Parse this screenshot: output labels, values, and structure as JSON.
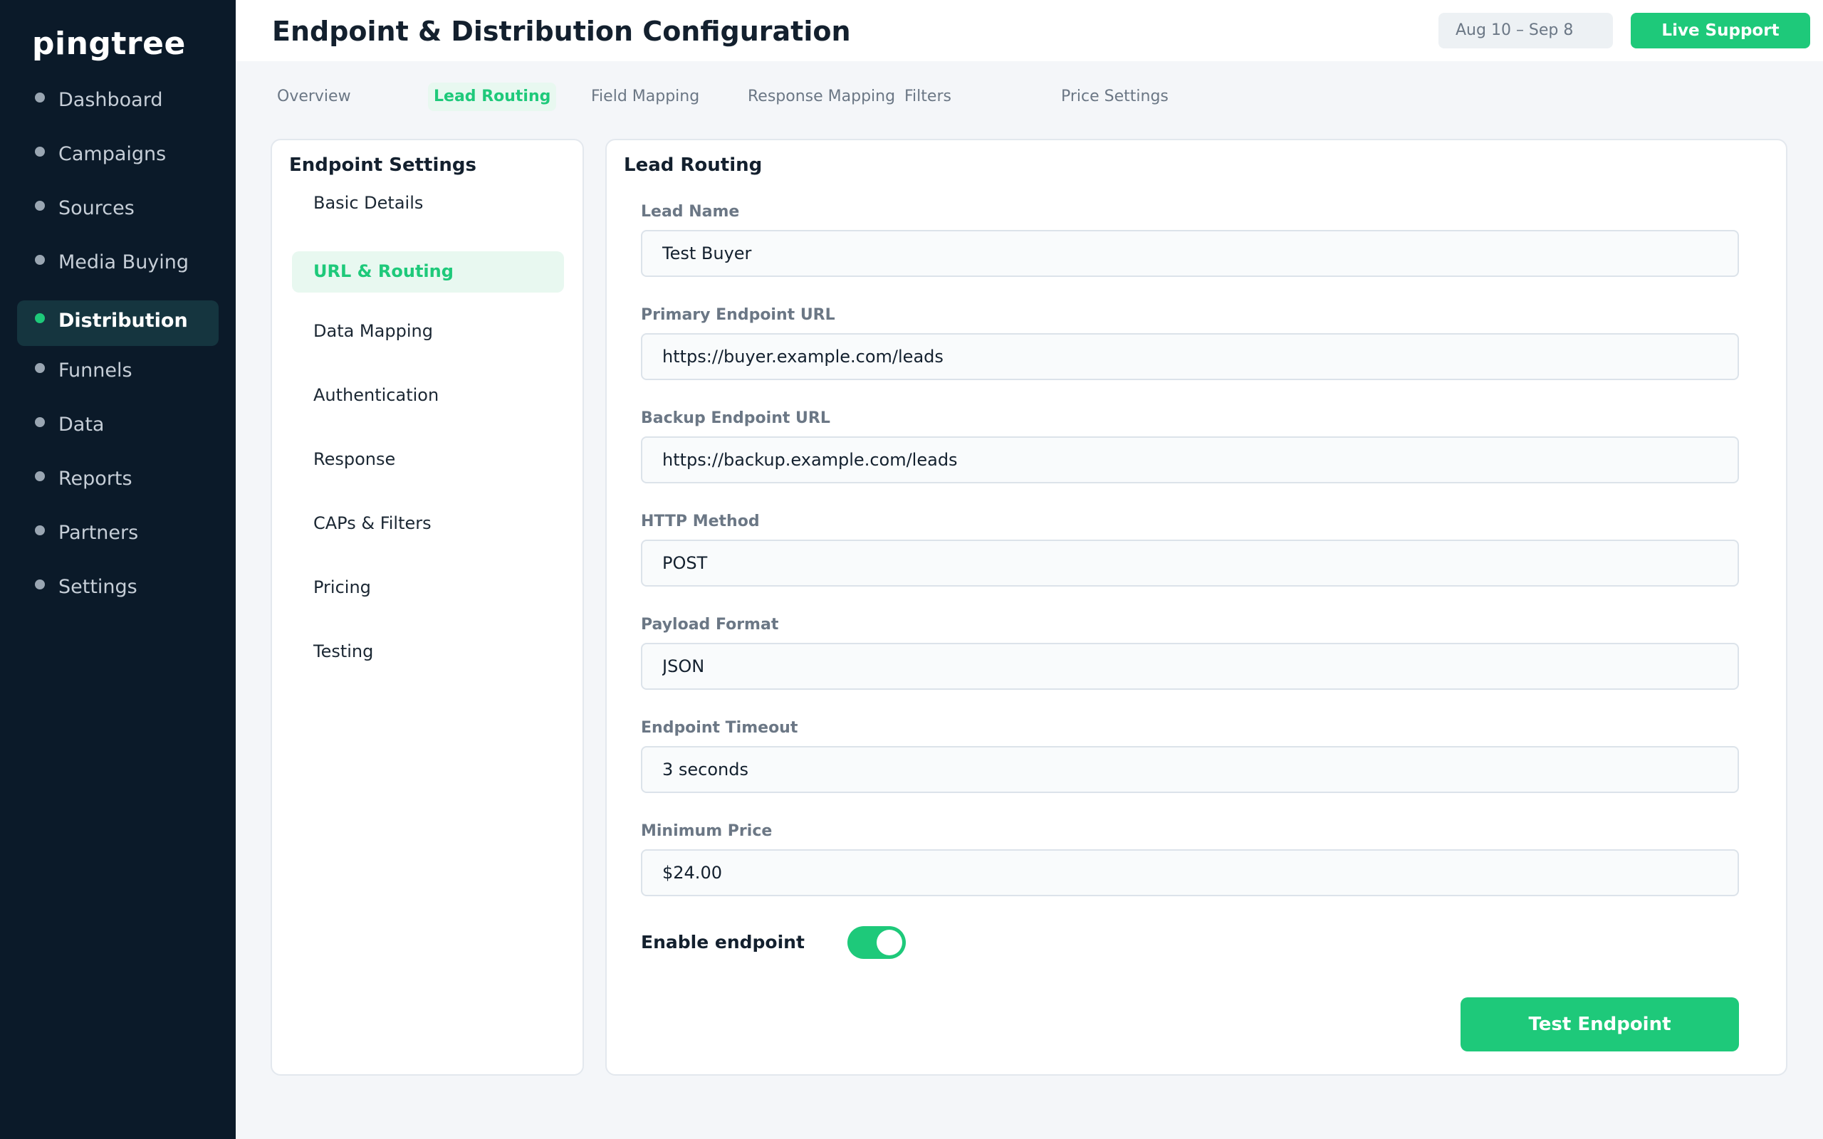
{
  "brand": "pingtree",
  "sidebar": {
    "items": [
      {
        "label": "Dashboard"
      },
      {
        "label": "Campaigns"
      },
      {
        "label": "Sources"
      },
      {
        "label": "Media Buying"
      },
      {
        "label": "Distribution",
        "active": true
      },
      {
        "label": "Funnels"
      },
      {
        "label": "Data"
      },
      {
        "label": "Reports"
      },
      {
        "label": "Partners"
      },
      {
        "label": "Settings"
      }
    ]
  },
  "header": {
    "title": "Endpoint & Distribution Configuration",
    "date_range": "Aug 10 – Sep 8",
    "live_support_label": "Live Support"
  },
  "tabs": [
    {
      "label": "Overview"
    },
    {
      "label": "Lead Routing",
      "active": true
    },
    {
      "label": "Field Mapping"
    },
    {
      "label": "Response Mapping"
    },
    {
      "label": "Filters"
    },
    {
      "label": "Price Settings"
    }
  ],
  "endpoint_settings": {
    "title": "Endpoint Settings",
    "items": [
      {
        "label": "Basic Details"
      },
      {
        "label": "URL & Routing",
        "active": true
      },
      {
        "label": "Data Mapping"
      },
      {
        "label": "Authentication"
      },
      {
        "label": "Response"
      },
      {
        "label": "CAPs & Filters"
      },
      {
        "label": "Pricing"
      },
      {
        "label": "Testing"
      }
    ]
  },
  "lead_routing": {
    "title": "Lead Routing",
    "fields": [
      {
        "label": "Lead Name",
        "value": "Test Buyer"
      },
      {
        "label": "Primary Endpoint URL",
        "value": "https://buyer.example.com/leads"
      },
      {
        "label": "Backup Endpoint URL",
        "value": "https://backup.example.com/leads"
      },
      {
        "label": "HTTP Method",
        "value": "POST"
      },
      {
        "label": "Payload Format",
        "value": "JSON"
      },
      {
        "label": "Endpoint Timeout",
        "value": "3 seconds"
      },
      {
        "label": "Minimum Price",
        "value": "$24.00"
      }
    ],
    "enable_label": "Enable endpoint",
    "enabled": true,
    "test_button_label": "Test Endpoint"
  },
  "colors": {
    "sidebar_bg": "#0b1a29",
    "accent": "#1ec97a",
    "active_tab_bg": "#e8f8f0"
  }
}
